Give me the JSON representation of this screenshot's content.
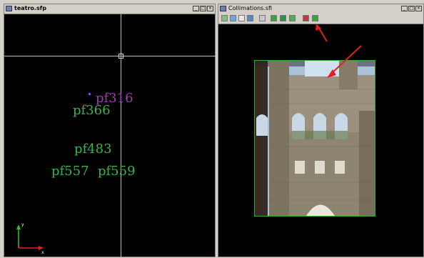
{
  "left_window": {
    "title": "teatro.sfp",
    "points": [
      {
        "label": "pf316",
        "color": "#9a3fae"
      },
      {
        "label": "pf366",
        "color": "#3fb24a"
      },
      {
        "label": "pf483",
        "color": "#3fb24a"
      },
      {
        "label": "pf557",
        "color": "#3fb24a"
      },
      {
        "label": "pf559",
        "color": "#3fb24a"
      }
    ],
    "axis_labels": {
      "x": "x",
      "y": "y"
    }
  },
  "right_window": {
    "title": "Collimations.sfi",
    "toolbar_icons": [
      "select-icon",
      "move-icon",
      "fit-icon",
      "rotate-icon",
      "zoom-icon",
      "collimation-add-icon",
      "collimation-edit-icon",
      "collimation-delete-icon",
      "prev-image-icon",
      "next-image-icon"
    ],
    "frame_color": "#3aa43a",
    "annotation_color": "#e02020"
  },
  "window_buttons": {
    "minimize": "_",
    "maximize": "□",
    "close": "×"
  }
}
